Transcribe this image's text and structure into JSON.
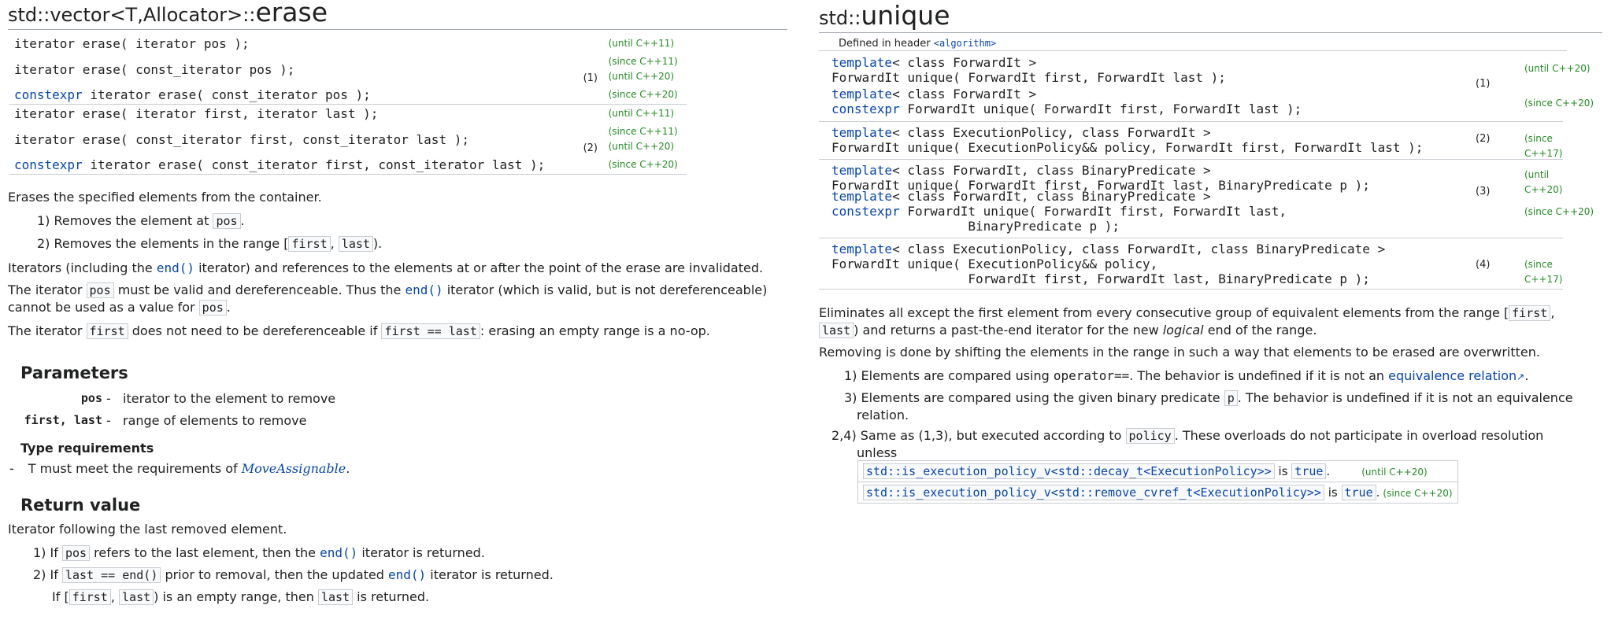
{
  "left": {
    "title_prefix": "std::vector<T,Allocator>::",
    "title_main": "erase",
    "decls": [
      {
        "kw": "",
        "code": "iterator erase( iterator pos );",
        "ver": "(until C++11)"
      },
      {
        "kw": "",
        "code": "iterator erase( const_iterator pos );",
        "ver": "(since C++11)",
        "ver2": "(until C++20)",
        "num": "(1)"
      },
      {
        "kw": "constexpr",
        "code": " iterator erase( const_iterator pos );",
        "ver": "(since C++20)"
      },
      {
        "kw": "",
        "code": "iterator erase( iterator first, iterator last );",
        "ver": "(until C++11)"
      },
      {
        "kw": "",
        "code": "iterator erase( const_iterator first, const_iterator last );",
        "ver": "(since C++11)",
        "ver2": "(until C++20)",
        "num": "(2)"
      },
      {
        "kw": "constexpr",
        "code": " iterator erase( const_iterator first, const_iterator last );",
        "ver": "(since C++20)"
      }
    ],
    "intro": "Erases the specified elements from the container.",
    "item1": {
      "pre": "1) Removes the element at ",
      "code": "pos",
      "post": "."
    },
    "item2": {
      "pre": "2) Removes the elements in the range [",
      "code1": "first",
      "mid": ", ",
      "code2": "last",
      "post": ")."
    },
    "iter_para": {
      "pre": "Iterators (including the ",
      "link": "end()",
      "post": " iterator) and references to the elements at or after the point of the erase are invalidated."
    },
    "pos_para": {
      "pre": "The iterator ",
      "code": "pos",
      "mid": " must be valid and dereferenceable. Thus the ",
      "link": "end()",
      "post": " iterator (which is valid, but is not dereferenceable)",
      "line2_pre": "cannot be used as a value for ",
      "line2_code": "pos",
      "line2_post": "."
    },
    "first_para": {
      "pre": "The iterator ",
      "code": "first",
      "mid": " does not need to be dereferenceable if ",
      "code2": "first == last",
      "post": ": erasing an empty range is a no-op."
    },
    "params_heading": "Parameters",
    "params": [
      {
        "name": "pos",
        "dash": "-",
        "desc": "iterator to the element to remove"
      },
      {
        "name": "first, last",
        "dash": "-",
        "desc": "range of elements to remove"
      }
    ],
    "type_req_heading": "Type requirements",
    "type_req": {
      "dash": "-",
      "pre": "T must meet the requirements of ",
      "link": "MoveAssignable",
      "post": "."
    },
    "return_heading": "Return value",
    "return_text": "Iterator following the last removed element.",
    "ret1": {
      "pre": "1) If ",
      "code": "pos",
      "mid": " refers to the last element, then the ",
      "link": "end()",
      "post": " iterator is returned."
    },
    "ret2": {
      "pre": "2) If ",
      "code": "last == end()",
      "mid": " prior to removal, then the updated ",
      "link": "end()",
      "post": " iterator is returned."
    },
    "ret3": {
      "pre": "If [",
      "code1": "first",
      "mid": ", ",
      "code2": "last",
      "mid2": ") is an empty range, then ",
      "code3": "last",
      "post": " is returned."
    }
  },
  "right": {
    "title_prefix": "std::",
    "title_main": "unique",
    "header_pre": "Defined in header ",
    "header_link": "<algorithm>",
    "decls": [
      {
        "l1kw": "template",
        "l1": "< class ForwardIt >",
        "l2kw": "",
        "l2": "ForwardIt unique( ForwardIt first, ForwardIt last );",
        "ver": "(until C++20)",
        "num": "(1)"
      },
      {
        "l1kw": "template",
        "l1": "< class ForwardIt >",
        "l2kw": "constexpr",
        "l2": " ForwardIt unique( ForwardIt first, ForwardIt last );",
        "ver": "(since C++20)"
      },
      {
        "l1kw": "template",
        "l1": "< class ExecutionPolicy, class ForwardIt >",
        "l2kw": "",
        "l2": "ForwardIt unique( ExecutionPolicy&& policy, ForwardIt first, ForwardIt last );",
        "ver": "(since C++17)",
        "num": "(2)"
      },
      {
        "l1kw": "template",
        "l1": "< class ForwardIt, class BinaryPredicate >",
        "l2kw": "",
        "l2": "ForwardIt unique( ForwardIt first, ForwardIt last, BinaryPredicate p );",
        "ver": "(until C++20)"
      },
      {
        "l1kw": "template",
        "l1": "< class ForwardIt, class BinaryPredicate >",
        "l2kw": "constexpr",
        "l2": " ForwardIt unique( ForwardIt first, ForwardIt last,",
        "l3": "                  BinaryPredicate p );",
        "ver": "(since C++20)",
        "num": "(3)"
      },
      {
        "l1kw": "template",
        "l1": "< class ExecutionPolicy, class ForwardIt, class BinaryPredicate >",
        "l2kw": "",
        "l2": "ForwardIt unique( ExecutionPolicy&& policy,",
        "l3": "                  ForwardIt first, ForwardIt last, BinaryPredicate p );",
        "ver": "(since C++17)",
        "num": "(4)"
      }
    ],
    "desc1": {
      "pre": "Eliminates all except the first element from every consecutive group of equivalent elements from the range [",
      "code1": "first",
      "mid": ",",
      "code2": "last",
      "post": ") and returns a past-the-end iterator for the new ",
      "em": "logical",
      "post2": " end of the range."
    },
    "desc2": "Removing is done by shifting the elements in the range in such a way that elements to be erased are overwritten.",
    "item1": {
      "pre": "1) Elements are compared using ",
      "op": "operator==",
      "mid": ". The behavior is undefined if it is not an ",
      "link": "equivalence relation",
      "post": "."
    },
    "item3": {
      "pre": "3) Elements are compared using the given binary predicate ",
      "code": "p",
      "post": ". The behavior is undefined if it is not an equivalence",
      "line2": "relation."
    },
    "item24": {
      "pre": "2,4) Same as (1,3), but executed according to ",
      "code": "policy",
      "post": ". These overloads do not participate in overload resolution",
      "line2": "unless"
    },
    "cond": [
      {
        "code": "std::is_execution_policy_v<std::decay_t<ExecutionPolicy>>",
        "is": " is ",
        "val": "true",
        "dot": ".",
        "ver": "(until C++20)"
      },
      {
        "code": "std::is_execution_policy_v<std::remove_cvref_t<ExecutionPolicy>>",
        "is": " is ",
        "val": "true",
        "dot": ".",
        "ver": "(since C++20)"
      }
    ]
  }
}
